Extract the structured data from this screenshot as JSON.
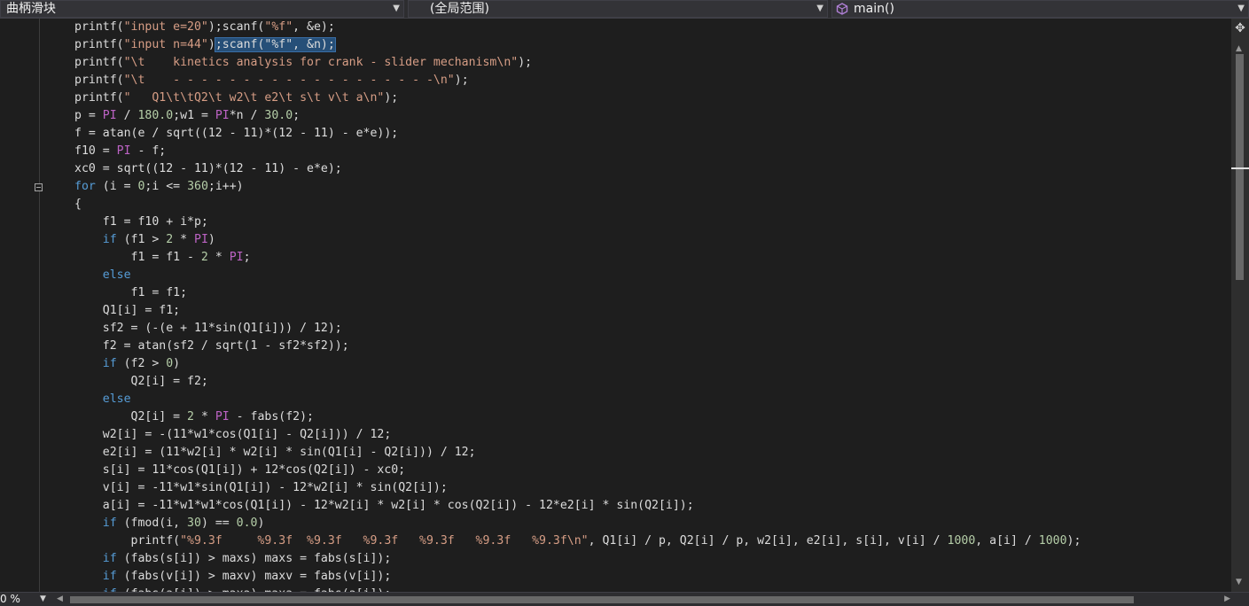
{
  "navbar": {
    "project": "曲柄滑块",
    "scope": "(全局范围)",
    "member": "main()",
    "member_icon": "method-cube-icon",
    "dropdown_icon": "chevron-down-icon"
  },
  "editor": {
    "lines": [
      [
        [
          "",
          "printf("
        ],
        [
          "str",
          "\"input e=20\""
        ],
        [
          "",
          ");scanf("
        ],
        [
          "str",
          "\"%f\""
        ],
        [
          "",
          ", &e);"
        ]
      ],
      [
        [
          "",
          "printf("
        ],
        [
          "str",
          "\"input n=44\""
        ],
        [
          "",
          ")"
        ],
        [
          "sel",
          ";scanf(\"%f\", &n);"
        ]
      ],
      [
        [
          "",
          "printf("
        ],
        [
          "str",
          "\"\\t    kinetics analysis for crank - slider mechanism\\n\""
        ],
        [
          "",
          ");"
        ]
      ],
      [
        [
          "",
          "printf("
        ],
        [
          "str",
          "\"\\t    - - - - - - - - - - - - - - - - - - -\\n\""
        ],
        [
          "",
          ");"
        ]
      ],
      [
        [
          "",
          "printf("
        ],
        [
          "str",
          "\"   Q1\\t\\tQ2\\t w2\\t e2\\t s\\t v\\t a\\n\""
        ],
        [
          "",
          ");"
        ]
      ],
      [
        [
          "",
          "p = "
        ],
        [
          "mac",
          "PI"
        ],
        [
          "",
          " / "
        ],
        [
          "num",
          "180.0"
        ],
        [
          "",
          ";w1 = "
        ],
        [
          "mac",
          "PI"
        ],
        [
          "",
          "*n / "
        ],
        [
          "num",
          "30.0"
        ],
        [
          "",
          ";"
        ]
      ],
      [
        [
          "",
          "f = atan(e / sqrt((12 - 11)*(12 - 11) - e*e));"
        ]
      ],
      [
        [
          "",
          "f10 = "
        ],
        [
          "mac",
          "PI"
        ],
        [
          "",
          " - f;"
        ]
      ],
      [
        [
          "",
          "xc0 = sqrt((12 - 11)*(12 - 11) - e*e);"
        ]
      ],
      [
        [
          "kw",
          "for"
        ],
        [
          "",
          " (i = "
        ],
        [
          "num",
          "0"
        ],
        [
          "",
          ";i <= "
        ],
        [
          "num",
          "360"
        ],
        [
          "",
          ";i++)"
        ]
      ],
      [
        [
          "",
          "{"
        ]
      ],
      [
        [
          "",
          "    f1 = f10 + i*p;"
        ]
      ],
      [
        [
          "kw",
          "    if"
        ],
        [
          "",
          " (f1 > "
        ],
        [
          "num",
          "2"
        ],
        [
          "",
          " * "
        ],
        [
          "mac",
          "PI"
        ],
        [
          "",
          ")"
        ]
      ],
      [
        [
          "",
          "        f1 = f1 - "
        ],
        [
          "num",
          "2"
        ],
        [
          "",
          " * "
        ],
        [
          "mac",
          "PI"
        ],
        [
          "",
          ";"
        ]
      ],
      [
        [
          "kw",
          "    else"
        ]
      ],
      [
        [
          "",
          "        f1 = f1;"
        ]
      ],
      [
        [
          "",
          "    Q1[i] = f1;"
        ]
      ],
      [
        [
          "",
          "    sf2 = (-(e + 11*sin(Q1[i])) / 12);"
        ]
      ],
      [
        [
          "",
          "    f2 = atan(sf2 / sqrt(1 - sf2*sf2));"
        ]
      ],
      [
        [
          "kw",
          "    if"
        ],
        [
          "",
          " (f2 > "
        ],
        [
          "num",
          "0"
        ],
        [
          "",
          ")"
        ]
      ],
      [
        [
          "",
          "        Q2[i] = f2;"
        ]
      ],
      [
        [
          "kw",
          "    else"
        ]
      ],
      [
        [
          "",
          "        Q2[i] = "
        ],
        [
          "num",
          "2"
        ],
        [
          "",
          " * "
        ],
        [
          "mac",
          "PI"
        ],
        [
          "",
          " - fabs(f2);"
        ]
      ],
      [
        [
          "",
          "    w2[i] = -(11*w1*cos(Q1[i] - Q2[i])) / 12;"
        ]
      ],
      [
        [
          "",
          "    e2[i] = (11*w2[i] * w2[i] * sin(Q1[i] - Q2[i])) / 12;"
        ]
      ],
      [
        [
          "",
          "    s[i] = 11*cos(Q1[i]) + 12*cos(Q2[i]) - xc0;"
        ]
      ],
      [
        [
          "",
          "    v[i] = -11*w1*sin(Q1[i]) - 12*w2[i] * sin(Q2[i]);"
        ]
      ],
      [
        [
          "",
          "    a[i] = -11*w1*w1*cos(Q1[i]) - 12*w2[i] * w2[i] * cos(Q2[i]) - 12*e2[i] * sin(Q2[i]);"
        ]
      ],
      [
        [
          "kw",
          "    if"
        ],
        [
          "",
          " (fmod(i, "
        ],
        [
          "num",
          "30"
        ],
        [
          "",
          ") == "
        ],
        [
          "num",
          "0.0"
        ],
        [
          "",
          ")"
        ]
      ],
      [
        [
          "",
          "        printf("
        ],
        [
          "str",
          "\"%9.3f     %9.3f  %9.3f   %9.3f   %9.3f   %9.3f   %9.3f\\n\""
        ],
        [
          "",
          ", Q1[i] / p, Q2[i] / p, w2[i], e2[i], s[i], v[i] / "
        ],
        [
          "num",
          "1000"
        ],
        [
          "",
          ", a[i] / "
        ],
        [
          "num",
          "1000"
        ],
        [
          "",
          ");"
        ]
      ],
      [
        [
          "kw",
          "    if"
        ],
        [
          "",
          " (fabs(s[i]) > maxs) maxs = fabs(s[i]);"
        ]
      ],
      [
        [
          "kw",
          "    if"
        ],
        [
          "",
          " (fabs(v[i]) > maxv) maxv = fabs(v[i]);"
        ]
      ],
      [
        [
          "kw",
          "    if"
        ],
        [
          "",
          " (fabs(a[i]) > maxa) maxa = fabs(a[i]);"
        ]
      ]
    ],
    "fold_lines": [
      9
    ]
  },
  "statusbar": {
    "zoom": "0 %"
  },
  "colors": {
    "background": "#1e1e1e",
    "text": "#dcdcdc",
    "string": "#d69d85",
    "keyword": "#569cd6",
    "macro": "#bd63c5",
    "selection": "#264f78"
  }
}
